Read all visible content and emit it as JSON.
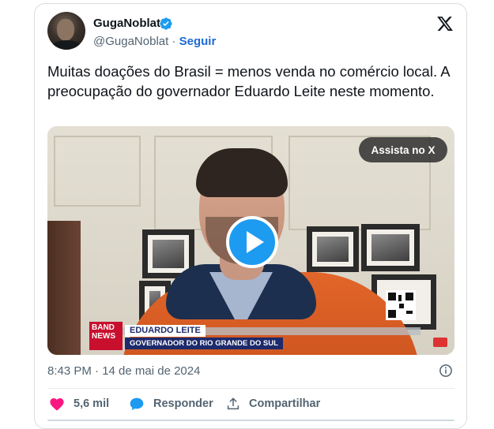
{
  "author": {
    "name": "GugaNoblat",
    "handle": "@GugaNoblat",
    "separator": "·",
    "follow_label": "Seguir",
    "verified_icon": "verified-badge-icon"
  },
  "tweet": {
    "text": "Muitas doações do Brasil = menos venda no comércio local. A preocupação do governador Eduardo Leite neste momento.",
    "timestamp": "8:43 PM · 14 de mai de 2024"
  },
  "media": {
    "watch_label": "Assista no X",
    "logo_text": "BAND NEWS",
    "lower_third_name": "EDUARDO LEITE",
    "lower_third_role": "GOVERNADOR DO RIO GRANDE DO SUL"
  },
  "actions": {
    "likes_count": "5,6 mil",
    "reply_label": "Responder",
    "share_label": "Compartilhar"
  },
  "colors": {
    "accent": "#1d9bf0",
    "link": "#1d6ad2",
    "like": "#f91880",
    "reply": "#1d9bf0",
    "muted": "#536471"
  }
}
